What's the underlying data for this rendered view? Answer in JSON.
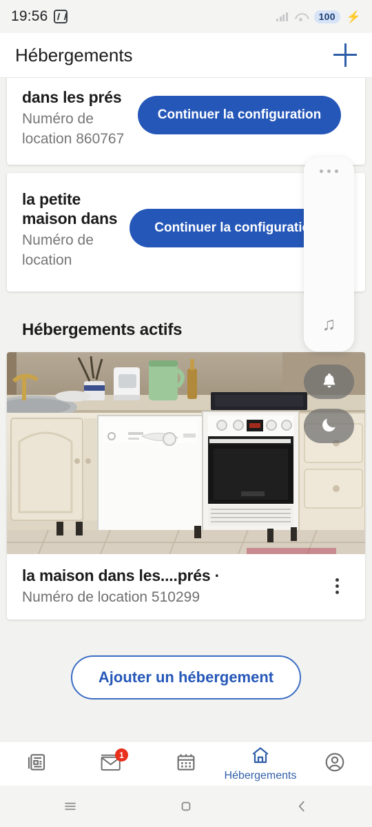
{
  "status_bar": {
    "time": "19:56",
    "nfc_icon": "nfc-icon",
    "signal_icon": "signal-bars-icon",
    "wifi_icon": "wifi-icon",
    "battery_level": "100",
    "charging_icon": "lightning-bolt-icon"
  },
  "header": {
    "title": "Hébergements",
    "add_icon": "plus-icon"
  },
  "setup_cards": [
    {
      "title": "dans les prés",
      "subtitle": "Numéro de location 860767",
      "button_label": "Continuer la configuration"
    },
    {
      "title": "la petite maison dans",
      "subtitle": "Numéro de location",
      "button_label": "Continuer la configuration"
    }
  ],
  "active_section": {
    "heading": "Hébergements actifs",
    "listing": {
      "photo_alt": "kitchen-photo",
      "name": "la maison dans les....prés ·",
      "subtitle": "Numéro de location 510299",
      "menu_icon": "kebab-menu-icon"
    }
  },
  "add_listing": {
    "label": "Ajouter un hébergement"
  },
  "bottom_nav": [
    {
      "name": "news",
      "icon": "newspaper-icon",
      "label": "",
      "badge": "",
      "active": false
    },
    {
      "name": "messages",
      "icon": "envelope-icon",
      "label": "",
      "badge": "1",
      "active": false
    },
    {
      "name": "calendar",
      "icon": "calendar-icon",
      "label": "",
      "badge": "",
      "active": false
    },
    {
      "name": "listings",
      "icon": "home-icon",
      "label": "Hébergements",
      "badge": "",
      "active": true
    },
    {
      "name": "profile",
      "icon": "person-circle-icon",
      "label": "",
      "badge": "",
      "active": false
    }
  ],
  "system_nav": {
    "recents_icon": "menu-lines-icon",
    "home_icon": "square-icon",
    "back_icon": "chevron-left-icon"
  },
  "overlays": {
    "edge_panel": {
      "handle_icon": "drag-handle-dots-icon",
      "music_icon": "music-note-icon"
    },
    "bell_button": {
      "icon": "bell-icon"
    },
    "moon_button": {
      "icon": "crescent-moon-icon"
    }
  },
  "colors": {
    "primary_blue": "#2557b8",
    "accent_blue": "#2f5ea8",
    "badge_red": "#e8301c",
    "page_background": "#f2f2f0"
  }
}
